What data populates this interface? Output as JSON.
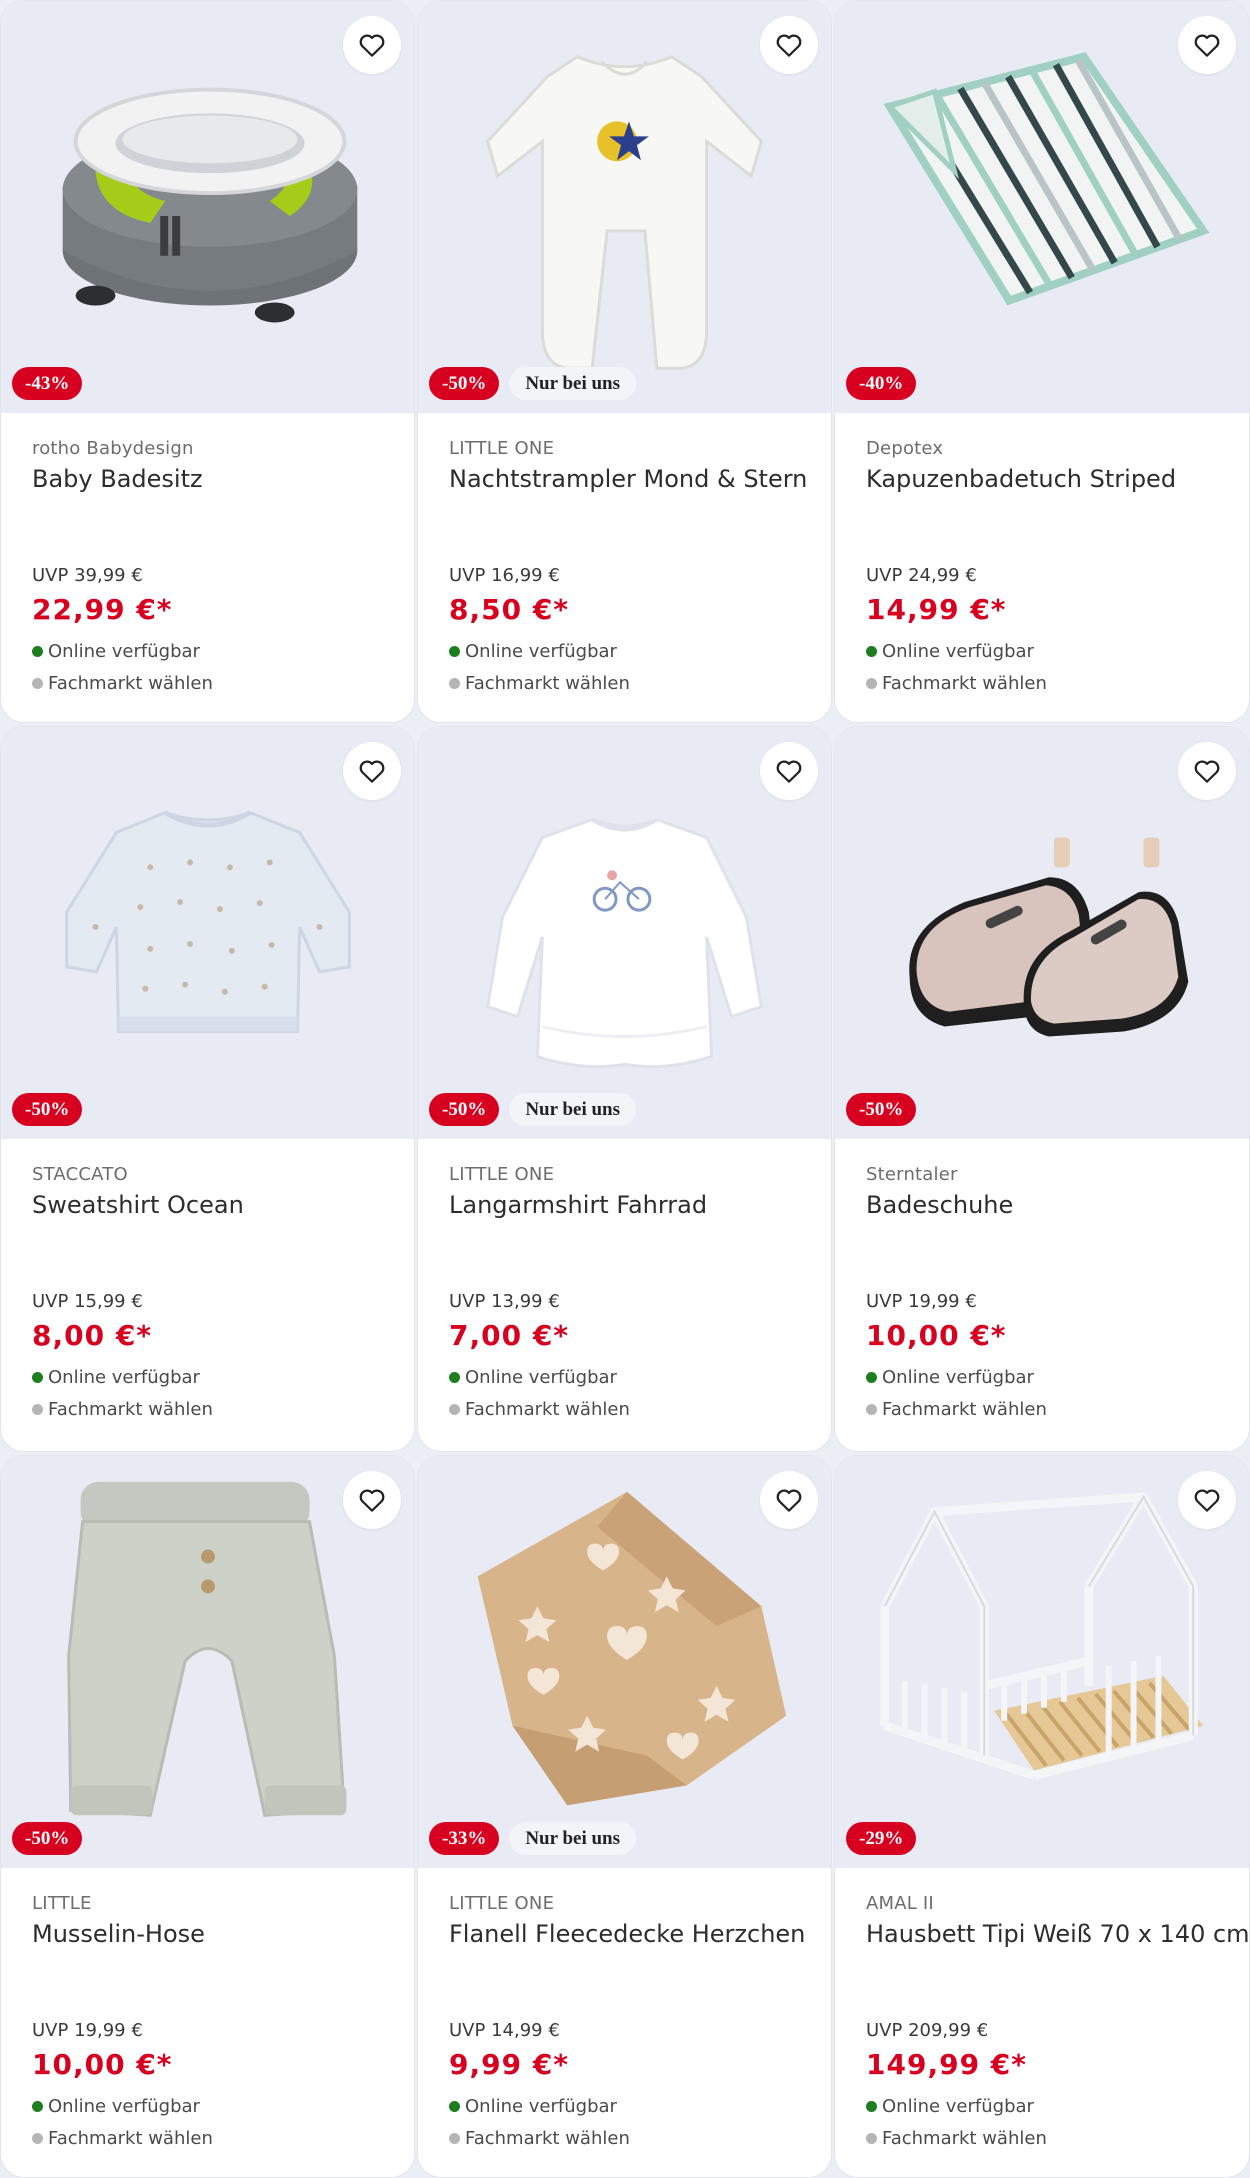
{
  "colors": {
    "discount": "#d8001f",
    "price": "#d8001f",
    "online": "#1e7d1e",
    "store": "#b5b5b5",
    "media_bg": "#e9ebf4"
  },
  "products": [
    {
      "brand": "rotho Babydesign",
      "name": "Baby Badesitz",
      "discount": "-43%",
      "uvp": "UVP 39,99 €",
      "price": "22,99 €*",
      "online": "Online verfügbar",
      "store": "Fachmarkt wählen",
      "image_icon": "bath-seat-image"
    },
    {
      "brand": "LITTLE ONE",
      "name": "Nachtstrampler Mond & Stern",
      "discount": "-50%",
      "tag": "Nur bei uns",
      "uvp": "UVP 16,99 €",
      "price": "8,50 €*",
      "online": "Online verfügbar",
      "store": "Fachmarkt wählen",
      "image_icon": "sleepsuit-image"
    },
    {
      "brand": "Depotex",
      "name": "Kapuzenbadetuch Striped",
      "discount": "-40%",
      "uvp": "UVP 24,99 €",
      "price": "14,99 €*",
      "online": "Online verfügbar",
      "store": "Fachmarkt wählen",
      "image_icon": "hooded-towel-image"
    },
    {
      "brand": "STACCATO",
      "name": "Sweatshirt Ocean",
      "discount": "-50%",
      "uvp": "UVP 15,99 €",
      "price": "8,00 €*",
      "online": "Online verfügbar",
      "store": "Fachmarkt wählen",
      "image_icon": "sweatshirt-image"
    },
    {
      "brand": "LITTLE ONE",
      "name": "Langarmshirt Fahrrad",
      "discount": "-50%",
      "tag": "Nur bei uns",
      "uvp": "UVP 13,99 €",
      "price": "7,00 €*",
      "online": "Online verfügbar",
      "store": "Fachmarkt wählen",
      "image_icon": "longsleeve-shirt-image"
    },
    {
      "brand": "Sterntaler",
      "name": "Badeschuhe",
      "discount": "-50%",
      "uvp": "UVP 19,99 €",
      "price": "10,00 €*",
      "online": "Online verfügbar",
      "store": "Fachmarkt wählen",
      "image_icon": "bath-shoes-image"
    },
    {
      "brand": "LITTLE",
      "name": "Musselin-Hose",
      "discount": "-50%",
      "uvp": "UVP 19,99 €",
      "price": "10,00 €*",
      "online": "Online verfügbar",
      "store": "Fachmarkt wählen",
      "image_icon": "muslin-pants-image"
    },
    {
      "brand": "LITTLE ONE",
      "name": "Flanell Fleecedecke Herzchen",
      "discount": "-33%",
      "tag": "Nur bei uns",
      "uvp": "UVP 14,99 €",
      "price": "9,99 €*",
      "online": "Online verfügbar",
      "store": "Fachmarkt wählen",
      "image_icon": "fleece-blanket-image"
    },
    {
      "brand": "AMAL II",
      "name": "Hausbett Tipi Weiß 70 x 140 cm",
      "discount": "-29%",
      "uvp": "UVP 209,99 €",
      "price": "149,99 €*",
      "online": "Online verfügbar",
      "store": "Fachmarkt wählen",
      "image_icon": "house-bed-image"
    }
  ]
}
